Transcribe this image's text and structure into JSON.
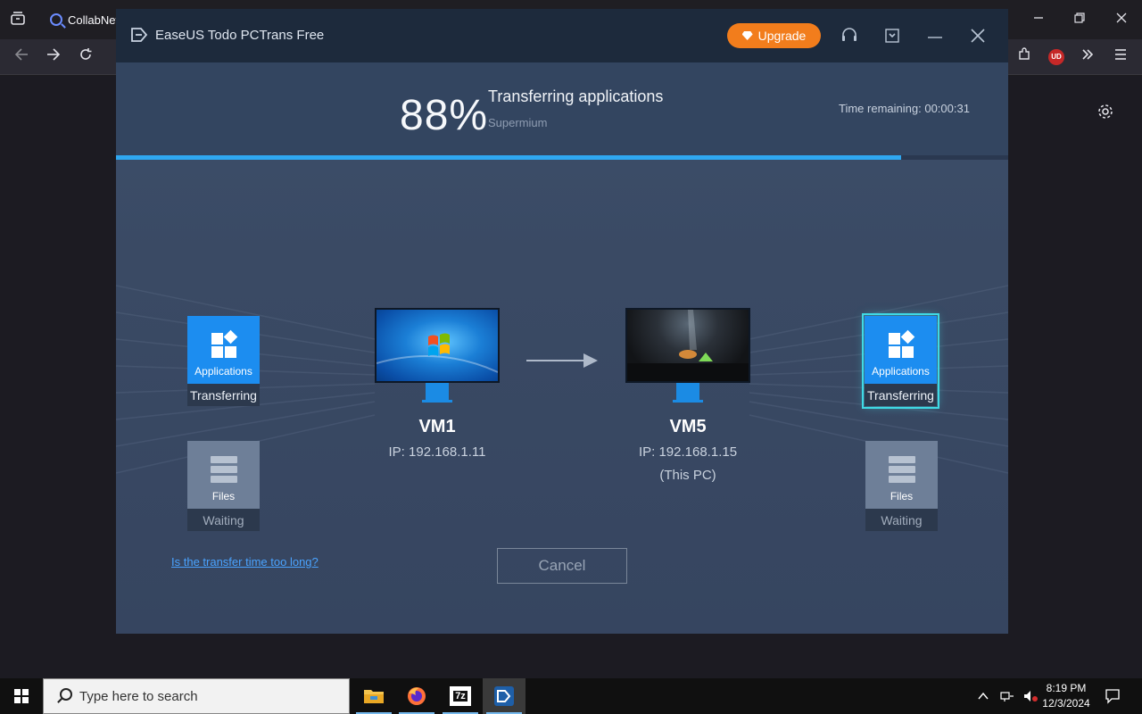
{
  "browser": {
    "tab_title": "CollabNet",
    "extension_badge": "UD"
  },
  "app": {
    "title": "EaseUS Todo PCTrans Free",
    "upgrade_label": "Upgrade",
    "percent_text": "88%",
    "progress_fraction": 0.88,
    "status_title": "Transferring applications",
    "status_subtitle": "Supermium",
    "time_remaining_label": "Time remaining:",
    "time_remaining_value": "00:00:31",
    "source": {
      "name": "VM1",
      "ip": "IP: 192.168.1.11"
    },
    "target": {
      "name": "VM5",
      "ip": "IP: 192.168.1.15",
      "note": "(This PC)"
    },
    "left_tiles": [
      {
        "label": "Applications",
        "status": "Transferring"
      },
      {
        "label": "Files",
        "status": "Waiting"
      }
    ],
    "right_tiles": [
      {
        "label": "Applications",
        "status": "Transferring"
      },
      {
        "label": "Files",
        "status": "Waiting"
      }
    ],
    "help_link": "Is the transfer time too long?",
    "cancel_label": "Cancel"
  },
  "taskbar": {
    "search_placeholder": "Type here to search",
    "seven_zip_label": "7z",
    "time": "8:19 PM",
    "date": "12/3/2024"
  },
  "colors": {
    "accent_blue": "#1c8df0",
    "progress": "#2fa7f0",
    "upgrade": "#f27d1c",
    "selected_outline": "#3fd9e4"
  }
}
